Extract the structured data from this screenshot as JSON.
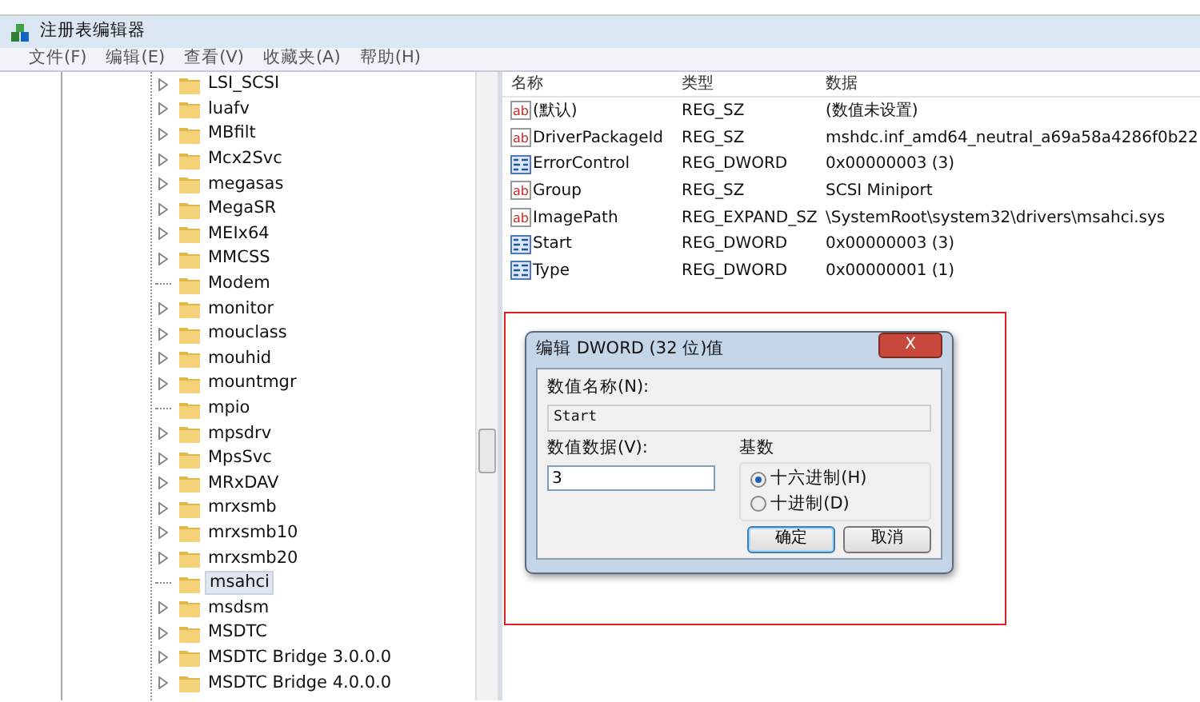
{
  "window": {
    "title": "注册表编辑器"
  },
  "menu": [
    "文件(F)",
    "编辑(E)",
    "查看(V)",
    "收藏夹(A)",
    "帮助(H)"
  ],
  "tree": [
    {
      "label": "LSI_SCSI",
      "expandable": true,
      "selected": false
    },
    {
      "label": "luafv",
      "expandable": true,
      "selected": false
    },
    {
      "label": "MBfilt",
      "expandable": true,
      "selected": false
    },
    {
      "label": "Mcx2Svc",
      "expandable": true,
      "selected": false
    },
    {
      "label": "megasas",
      "expandable": true,
      "selected": false
    },
    {
      "label": "MegaSR",
      "expandable": true,
      "selected": false
    },
    {
      "label": "MEIx64",
      "expandable": true,
      "selected": false
    },
    {
      "label": "MMCSS",
      "expandable": true,
      "selected": false
    },
    {
      "label": "Modem",
      "expandable": false,
      "selected": false
    },
    {
      "label": "monitor",
      "expandable": true,
      "selected": false
    },
    {
      "label": "mouclass",
      "expandable": true,
      "selected": false
    },
    {
      "label": "mouhid",
      "expandable": true,
      "selected": false
    },
    {
      "label": "mountmgr",
      "expandable": true,
      "selected": false
    },
    {
      "label": "mpio",
      "expandable": false,
      "selected": false
    },
    {
      "label": "mpsdrv",
      "expandable": true,
      "selected": false
    },
    {
      "label": "MpsSvc",
      "expandable": true,
      "selected": false
    },
    {
      "label": "MRxDAV",
      "expandable": true,
      "selected": false
    },
    {
      "label": "mrxsmb",
      "expandable": true,
      "selected": false
    },
    {
      "label": "mrxsmb10",
      "expandable": true,
      "selected": false
    },
    {
      "label": "mrxsmb20",
      "expandable": true,
      "selected": false
    },
    {
      "label": "msahci",
      "expandable": false,
      "selected": true
    },
    {
      "label": "msdsm",
      "expandable": true,
      "selected": false
    },
    {
      "label": "MSDTC",
      "expandable": true,
      "selected": false
    },
    {
      "label": "MSDTC Bridge 3.0.0.0",
      "expandable": true,
      "selected": false
    },
    {
      "label": "MSDTC Bridge 4.0.0.0",
      "expandable": true,
      "selected": false
    }
  ],
  "values": {
    "columns": [
      "名称",
      "类型",
      "数据"
    ],
    "rows": [
      {
        "kind": "string",
        "icon_text": "ab",
        "name": "(默认)",
        "type": "REG_SZ",
        "data": "(数值未设置)"
      },
      {
        "kind": "string",
        "icon_text": "ab",
        "name": "DriverPackageId",
        "type": "REG_SZ",
        "data": "mshdc.inf_amd64_neutral_a69a58a4286f0b22"
      },
      {
        "kind": "dword",
        "name": "ErrorControl",
        "type": "REG_DWORD",
        "data": "0x00000003 (3)"
      },
      {
        "kind": "string",
        "icon_text": "ab",
        "name": "Group",
        "type": "REG_SZ",
        "data": "SCSI Miniport"
      },
      {
        "kind": "string",
        "icon_text": "ab",
        "name": "ImagePath",
        "type": "REG_EXPAND_SZ",
        "data": "\\SystemRoot\\system32\\drivers\\msahci.sys"
      },
      {
        "kind": "dword",
        "name": "Start",
        "type": "REG_DWORD",
        "data": "0x00000003 (3)"
      },
      {
        "kind": "dword",
        "name": "Type",
        "type": "REG_DWORD",
        "data": "0x00000001 (1)"
      }
    ]
  },
  "dialog": {
    "title": "编辑 DWORD (32 位)值",
    "close": "X",
    "name_label": "数值名称(N):",
    "name_value": "Start",
    "data_label": "数值数据(V):",
    "data_value": "3",
    "base_label": "基数",
    "radios": [
      {
        "label": "十六进制(H)",
        "selected": true
      },
      {
        "label": "十进制(D)",
        "selected": false
      }
    ],
    "buttons": [
      {
        "label": "确定",
        "default": true
      },
      {
        "label": "取消",
        "default": false
      }
    ]
  }
}
